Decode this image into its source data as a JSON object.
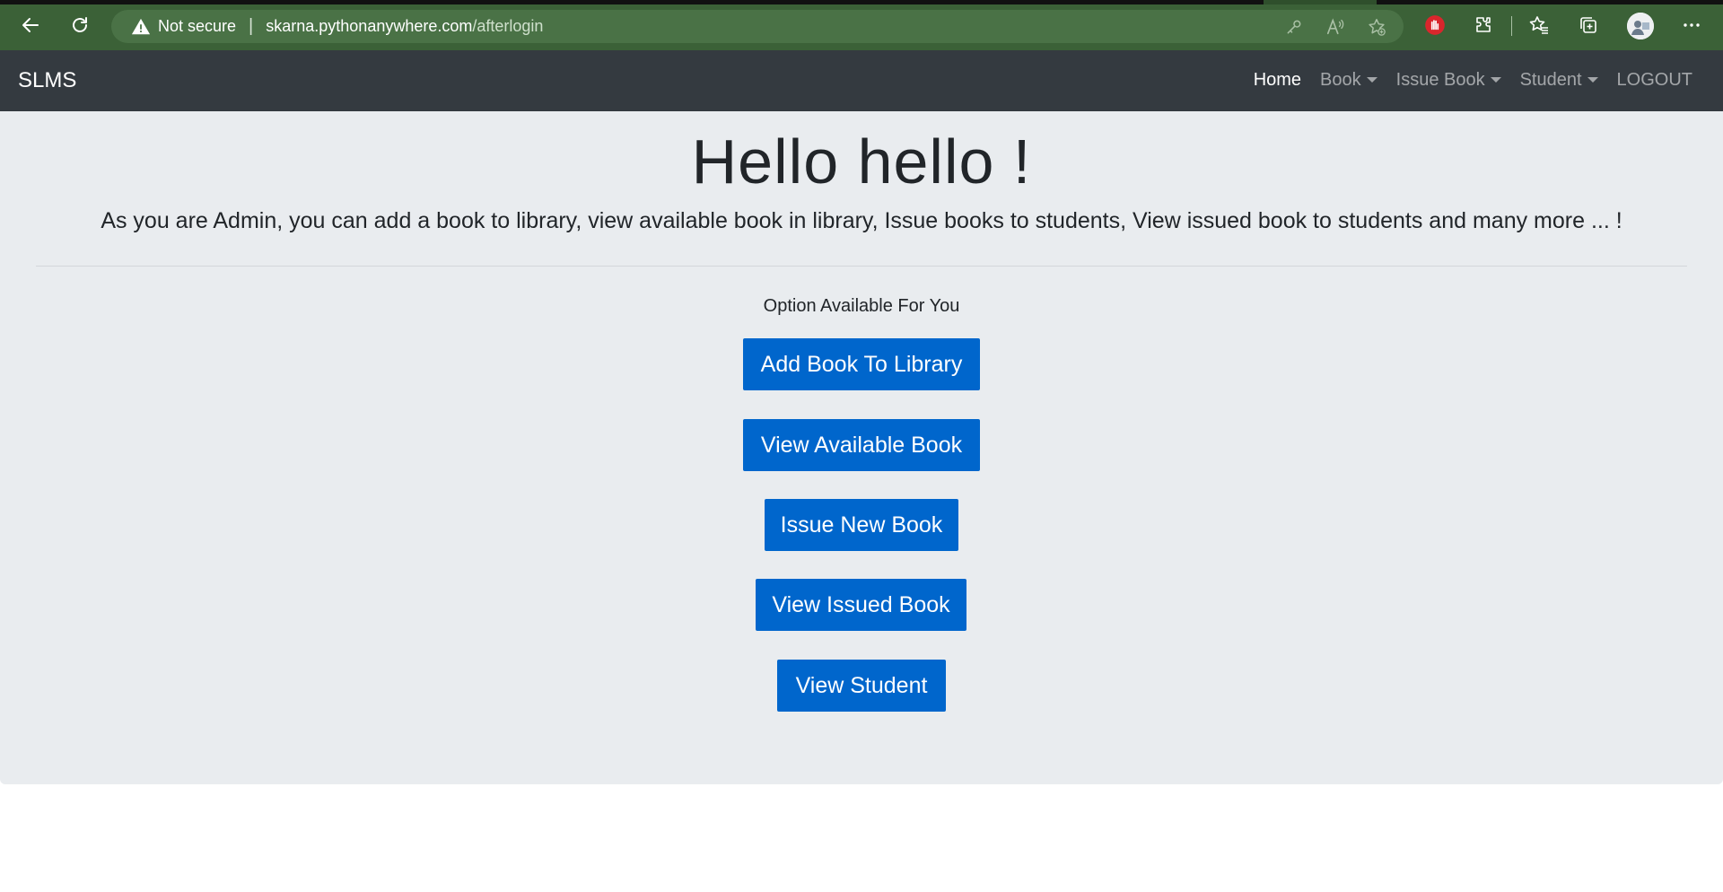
{
  "browser": {
    "not_secure_label": "Not secure",
    "url_host": "skarna.pythonanywhere.com",
    "url_path": "/afterlogin",
    "icons": [
      "back-arrow-icon",
      "refresh-icon",
      "warning-icon",
      "key-icon",
      "read-aloud-icon",
      "favorite-add-icon",
      "hand-stop-icon",
      "extensions-icon",
      "favorites-icon",
      "collections-icon",
      "profile-avatar",
      "more-icon"
    ],
    "theme_color": "#3b6137"
  },
  "navbar": {
    "brand": "SLMS",
    "items": [
      {
        "label": "Home",
        "active": true,
        "dropdown": false
      },
      {
        "label": "Book",
        "active": false,
        "dropdown": true
      },
      {
        "label": "Issue Book",
        "active": false,
        "dropdown": true
      },
      {
        "label": "Student",
        "active": false,
        "dropdown": true
      },
      {
        "label": "LOGOUT",
        "active": false,
        "dropdown": false
      }
    ],
    "background": "#343a40"
  },
  "main": {
    "headline": "Hello hello !",
    "lead": "As you are Admin, you can add a book to library, view available book in library, Issue books to students, View issued book to students and many more ... !",
    "options_label": "Option Available For You",
    "buttons": [
      {
        "label": "Add Book To Library"
      },
      {
        "label": "View Available Book"
      },
      {
        "label": "Issue New Book"
      },
      {
        "label": "View Issued Book"
      },
      {
        "label": "View Student"
      }
    ],
    "button_color": "#0066cc",
    "background": "#e9ecef"
  }
}
